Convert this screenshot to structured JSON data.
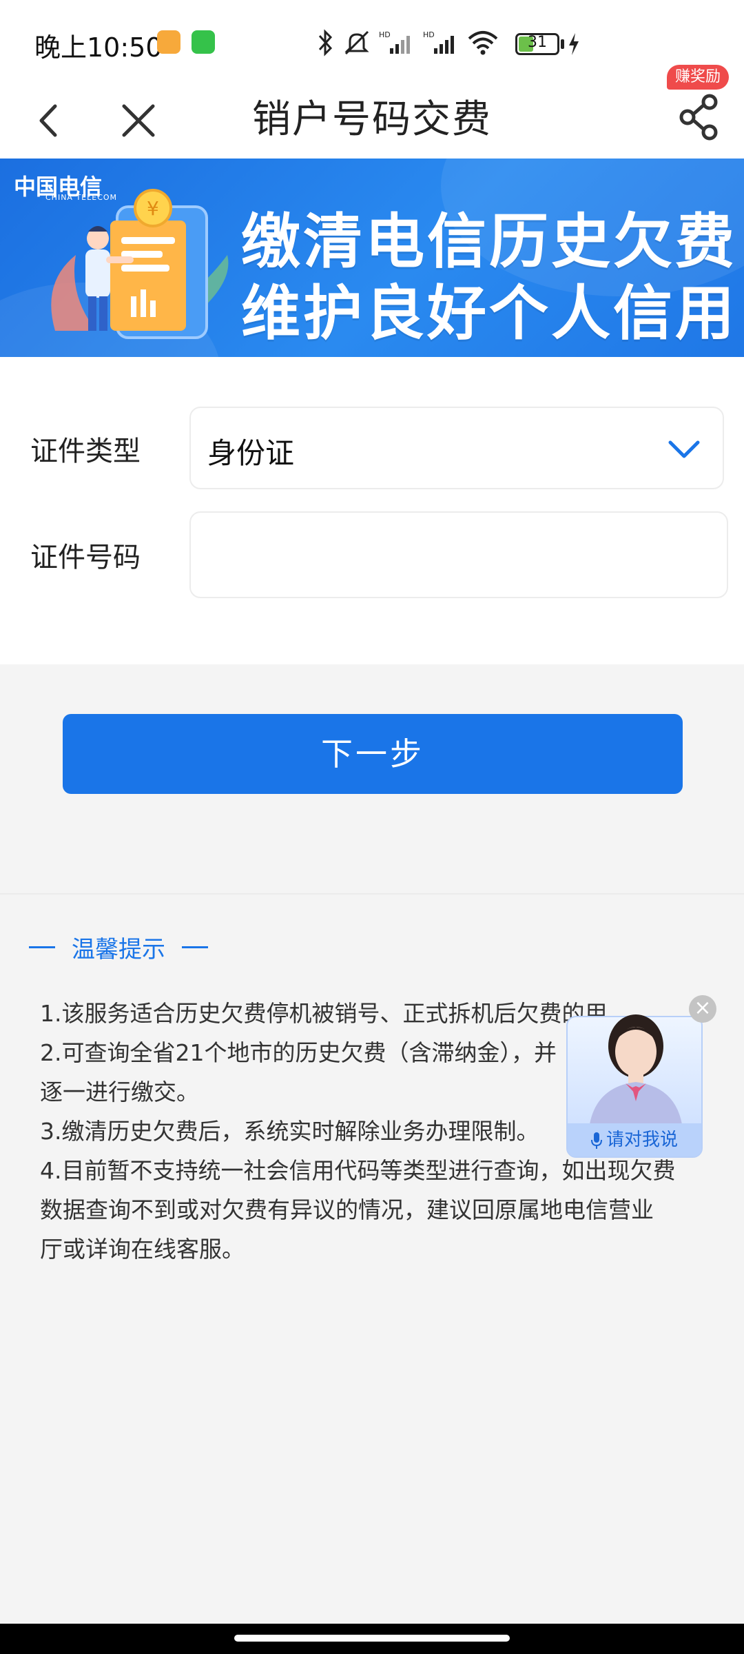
{
  "status_bar": {
    "time": "晚上10:50",
    "battery_level": "31",
    "app_icon_1_color": "#f7a93b",
    "app_icon_2_color": "#35c24a",
    "icons": [
      "bluetooth-icon",
      "mute-icon",
      "signal-hd-icon",
      "signal-hd-icon",
      "wifi-icon",
      "battery-icon",
      "charging-icon"
    ]
  },
  "nav": {
    "title": "销户号码交费",
    "badge": "赚奖励",
    "back_icon": "chevron-left-icon",
    "close_icon": "close-icon",
    "share_icon": "share-icon"
  },
  "banner": {
    "brand": "中国电信",
    "brand_sub": "CHINA TELECOM",
    "line1": "缴清电信历史欠费",
    "line2": "维护良好个人信用"
  },
  "form": {
    "id_type_label": "证件类型",
    "id_type_value": "身份证",
    "id_number_label": "证件号码",
    "id_number_value": "",
    "id_number_placeholder": ""
  },
  "actions": {
    "next_label": "下一步"
  },
  "tips": {
    "title": "温馨提示",
    "items": [
      "1.该服务适合历史欠费停机被销号、正式拆机后欠费的用",
      "2.可查询全省21个地市的历史欠费（含滞纳金），并",
      "逐一进行缴交。",
      "3.缴清历史欠费后，系统实时解除业务办理限制。",
      "4.目前暂不支持统一社会信用代码等类型进行查询，如出现欠费",
      "数据查询不到或对欠费有异议的情况，建议回原属地电信营业",
      "厅或详询在线客服。"
    ]
  },
  "assistant": {
    "prompt": "请对我说"
  },
  "colors": {
    "accent": "#1a75e8",
    "badge": "#ef4b4b",
    "page_bg": "#f4f4f4"
  }
}
